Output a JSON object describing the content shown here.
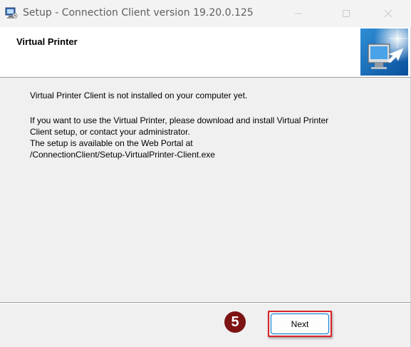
{
  "window": {
    "title": "Setup - Connection Client version 19.20.0.125",
    "icon": "setup-computer-icon"
  },
  "header": {
    "title": "Virtual Printer",
    "graphic": "computer-arrow-graphic"
  },
  "content": {
    "line1": "Virtual Printer Client is not installed on your computer yet.",
    "line2": "If you want to use the Virtual Printer, please download and install Virtual Printer",
    "line3": "Client setup, or contact your administrator.",
    "line4": "The setup is available on the Web Portal at",
    "line5": "/ConnectionClient/Setup-VirtualPrinter-Client.exe"
  },
  "footer": {
    "step_number": "5",
    "next_label": "Next"
  },
  "colors": {
    "badge": "#7d1414",
    "highlight": "#d9242a",
    "button_border": "#0078d7"
  }
}
